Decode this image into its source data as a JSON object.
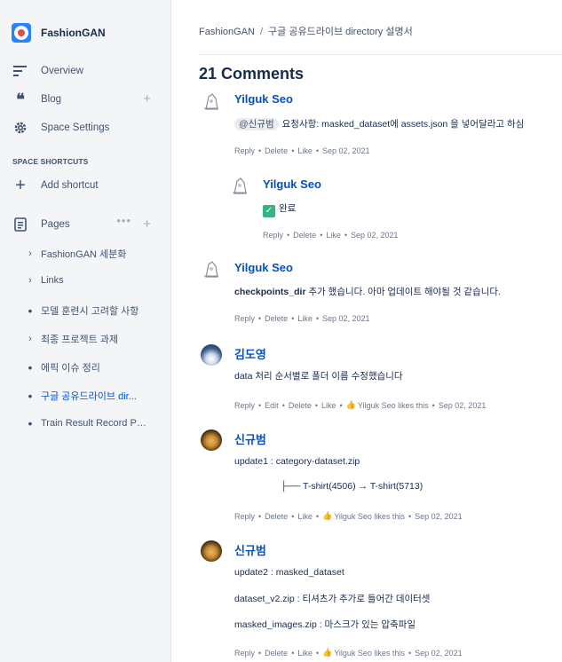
{
  "space": {
    "name": "FashionGAN"
  },
  "nav": {
    "overview": "Overview",
    "blog": "Blog",
    "settings": "Space Settings",
    "shortcuts_label": "SPACE SHORTCUTS",
    "add_shortcut": "Add shortcut",
    "pages": "Pages"
  },
  "tree": [
    {
      "label": "FashionGAN 세분화",
      "type": "chevron"
    },
    {
      "label": "Links",
      "type": "chevron"
    },
    {
      "label": "모델 훈련시 고려할 사항",
      "type": "bullet"
    },
    {
      "label": "최종 프로젝트 과제",
      "type": "chevron"
    },
    {
      "label": "에픽 이슈 정리",
      "type": "bullet"
    },
    {
      "label": "구글 공유드라이브 dir...",
      "type": "bullet",
      "active": true
    },
    {
      "label": "Train Result Record Page",
      "type": "bullet"
    }
  ],
  "breadcrumb": {
    "space": "FashionGAN",
    "separator": "/",
    "page": "구글 공유드라이브 directory 설명서"
  },
  "comments_title": "21 Comments",
  "comments": [
    {
      "author": "Yilguk Seo",
      "mention": "@신규범",
      "body": "요청사항: masked_dataset에 assets.json 을 넣어달라고 하심",
      "actions": [
        "Reply",
        "Delete",
        "Like",
        "Sep 02, 2021"
      ]
    },
    {
      "author": "Yilguk Seo",
      "body": "완료",
      "actions": [
        "Reply",
        "Delete",
        "Like",
        "Sep 02, 2021"
      ]
    },
    {
      "author": "Yilguk Seo",
      "body_bold": "checkpoints_dir",
      "body": " 추가 했습니다. 아마 업데이트 해야될 것 같습니다.",
      "actions": [
        "Reply",
        "Delete",
        "Like",
        "Sep 02, 2021"
      ]
    },
    {
      "author": "김도영",
      "body": "data 처리 순서별로 폴더 이름 수정했습니다",
      "actions": [
        "Reply",
        "Edit",
        "Delete",
        "Like",
        "Yilguk Seo likes this",
        "Sep 02, 2021"
      ]
    },
    {
      "author": "신규범",
      "body": "update1 : category-dataset.zip",
      "body2": "├──  T-shirt(4506) → T-shirt(5713)",
      "actions": [
        "Reply",
        "Delete",
        "Like",
        "Yilguk Seo likes this",
        "Sep 02, 2021"
      ]
    },
    {
      "author": "신규범",
      "body": "update2 : masked_dataset",
      "body2": "dataset_v2.zip : 티셔츠가 추가로 들어간 데이터셋",
      "body3": "masked_images.zip : 마스크가 있는 압축파일",
      "actions": [
        "Reply",
        "Delete",
        "Like",
        "Yilguk Seo likes this",
        "Sep 02, 2021"
      ]
    }
  ]
}
